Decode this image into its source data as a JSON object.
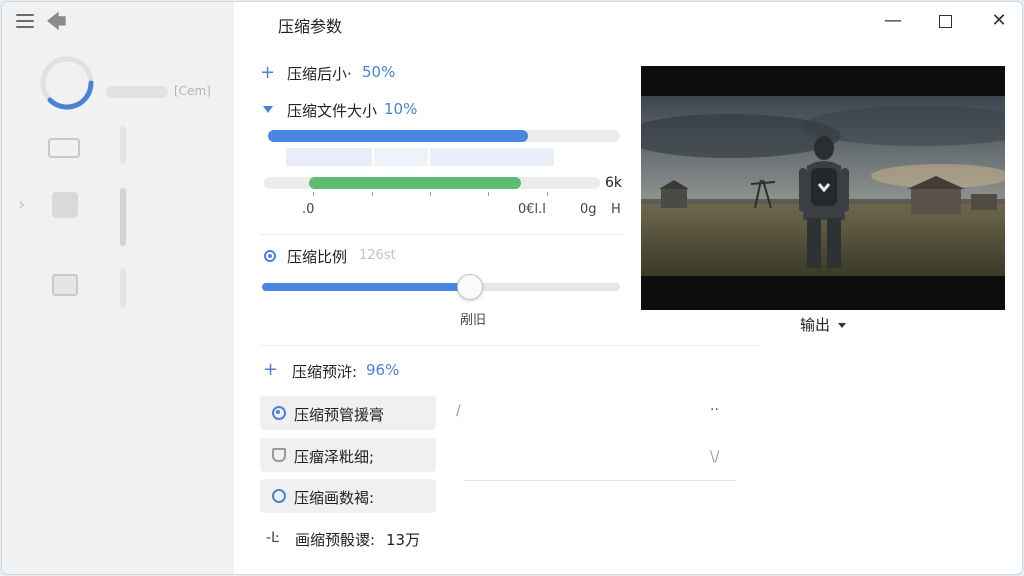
{
  "window": {
    "title": "压缩参数"
  },
  "sidebar": {
    "tag": "[Cem]"
  },
  "controls": {
    "size_after": {
      "label": "压缩后小·",
      "value": "50%"
    },
    "file_size": {
      "label": "压缩文件大小",
      "value": "10%",
      "bar_progress": 0.74,
      "range_start": 0.135,
      "range_end": 0.765,
      "axis_left": ".0",
      "axis_mid": "0€l.l",
      "axis_right_a": "0g",
      "axis_right_b": "H",
      "range_max": "6k"
    },
    "ratio": {
      "label": "压缩比例",
      "value": "126st",
      "slider_progress": 0.58,
      "slider_caption": "剐旧"
    },
    "preset": {
      "label": "压缩预浒:",
      "value": "96%",
      "options": [
        {
          "label": "压缩预管援膏",
          "icon": "radio-selected-icon",
          "right": "/",
          "right_b": "··"
        },
        {
          "label": "压瘤泽粃细;",
          "icon": "shield-icon",
          "right": "",
          "right_b": "\\/"
        },
        {
          "label": "压缩画数褐:",
          "icon": "radio-empty-icon",
          "right": "",
          "right_b": ""
        }
      ]
    },
    "footer": {
      "prefix": "-Ŀ",
      "label": "画缩预骰谡:",
      "value": "13万"
    }
  },
  "preview": {
    "output_label": "输出"
  },
  "colors": {
    "accent": "#4a82d6",
    "green": "#5dbb72",
    "ring_blue": "#4a82d6"
  }
}
